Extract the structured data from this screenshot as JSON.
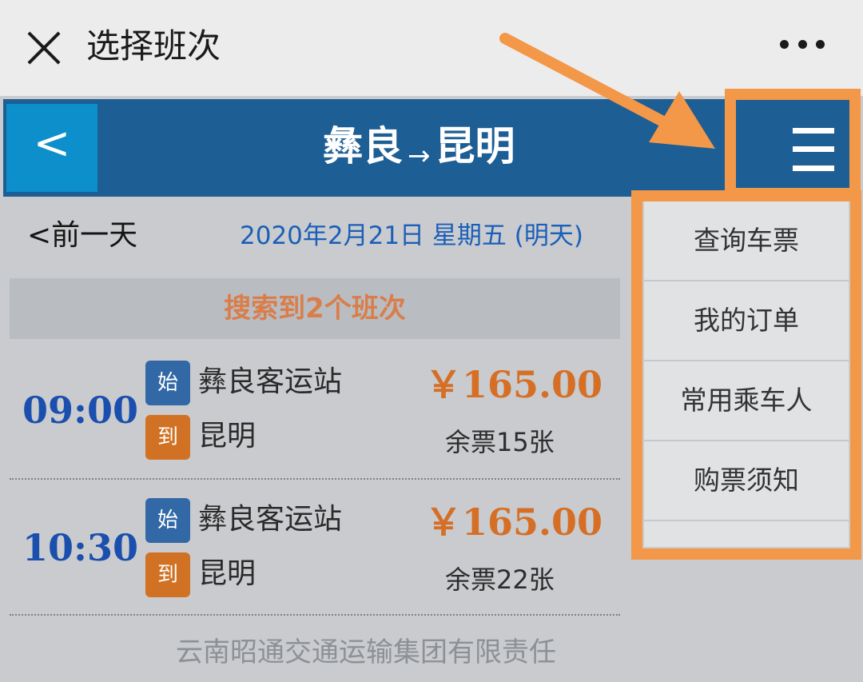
{
  "topbar": {
    "title": "选择班次",
    "close_icon": "close-icon",
    "more_icon": "more-icon"
  },
  "header": {
    "back_label": "<",
    "origin": "彝良",
    "arrow": "→",
    "destination": "昆明",
    "menu_icon": "hamburger-menu-icon",
    "color": "#1d5e94"
  },
  "date_bar": {
    "prev_label": "<前一天",
    "date": "2020年2月21日 星期五 (明天)"
  },
  "result_banner": "搜索到2个班次",
  "trips": [
    {
      "time": "09:00",
      "start_badge": "始",
      "start_station": "彝良客运站",
      "end_badge": "到",
      "end_station": "昆明",
      "price": "￥165.00",
      "remaining": "余票15张"
    },
    {
      "time": "10:30",
      "start_badge": "始",
      "start_station": "彝良客运站",
      "end_badge": "到",
      "end_station": "昆明",
      "price": "￥165.00",
      "remaining": "余票22张"
    }
  ],
  "footer": "云南昭通交通运输集团有限责任",
  "menu": {
    "items": [
      {
        "label": "查询车票"
      },
      {
        "label": "我的订单"
      },
      {
        "label": "常用乘车人"
      },
      {
        "label": "购票须知"
      }
    ]
  },
  "colors": {
    "accent": "#1d5e94",
    "price": "#d66f26",
    "annotation": "#f39748"
  }
}
